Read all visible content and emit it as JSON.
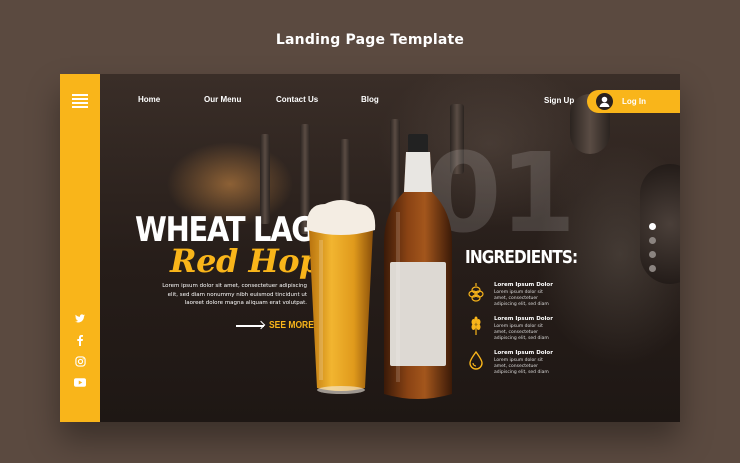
{
  "header": {
    "title": "Landing Page Template"
  },
  "nav": {
    "items": [
      "Home",
      "Our Menu",
      "Contact Us",
      "Blog"
    ]
  },
  "auth": {
    "signup_label": "Sign Up",
    "login_label": "Log In"
  },
  "hero": {
    "title": "WHEAT LAGER",
    "subtitle": "Red Hops",
    "body": "Lorem ipsum dolor sit amet, consectetuer adipiscing elit, sed diam nonummy nibh euismod tincidunt ut laoreet dolore magna aliquam erat volutpat.",
    "see_more": "SEE MORE",
    "big_number": "01"
  },
  "ingredients": {
    "title": "INGREDIENTS:",
    "items": [
      {
        "name": "Lorem Ipsum Dolor",
        "desc": "Lorem ipsum dolor sit amet, consectetuer adipiscing elit, sed diam",
        "icon": "hops-icon"
      },
      {
        "name": "Lorem Ipsum Dolor",
        "desc": "Lorem ipsum dolor sit amet, consectetuer adipiscing elit, sed diam",
        "icon": "wheat-icon"
      },
      {
        "name": "Lorem Ipsum Dolor",
        "desc": "Lorem ipsum dolor sit amet, consectetuer adipiscing elit, sed diam",
        "icon": "water-drop-icon"
      }
    ]
  },
  "social": [
    "twitter-icon",
    "facebook-icon",
    "instagram-icon",
    "youtube-icon"
  ],
  "pager": {
    "count": 4,
    "active": 0
  },
  "colors": {
    "accent": "#f9b51a",
    "page_bg": "#5b4a40",
    "frame_bg": "#2a211d"
  }
}
